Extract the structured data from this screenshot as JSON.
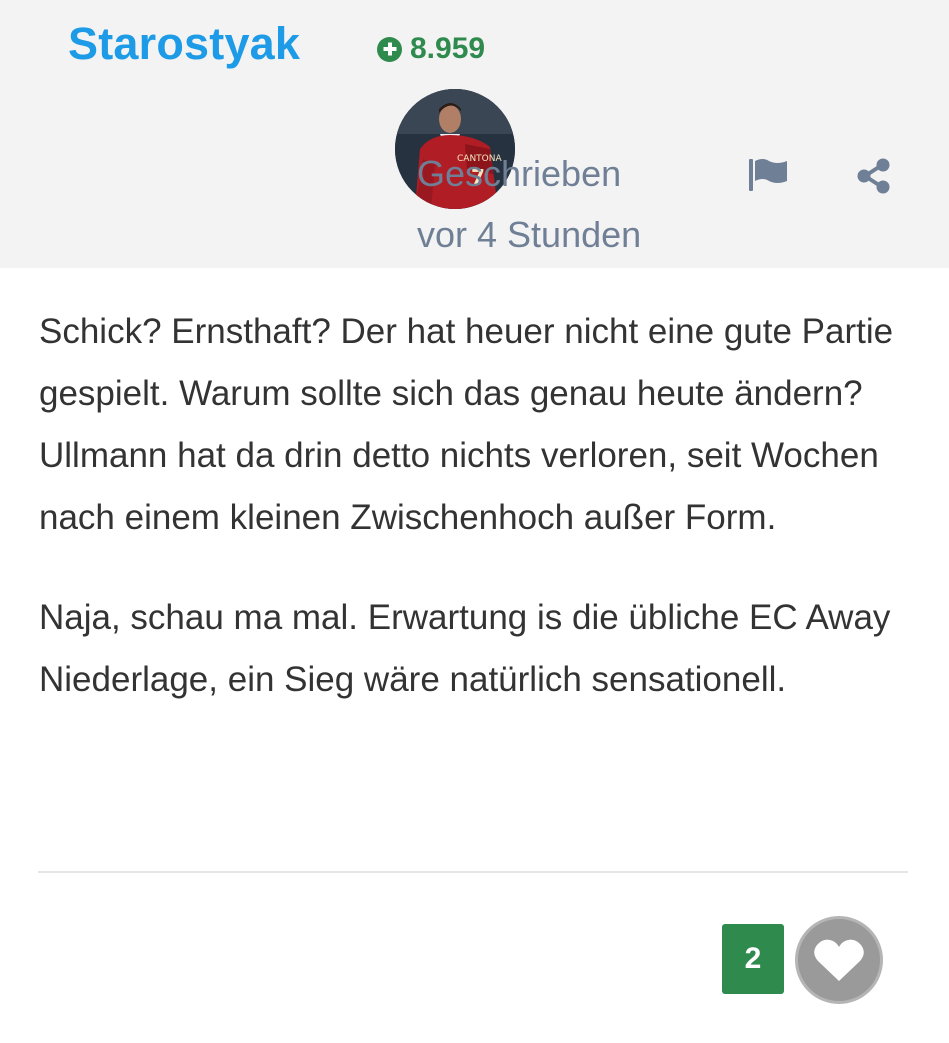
{
  "author": {
    "username": "Starostyak",
    "reputation": "8.959",
    "reputation_icon": "plus-circle-icon",
    "avatar_icon": "user-avatar"
  },
  "meta": {
    "posted_label": "Geschrieben",
    "posted_time": "vor 4 Stunden"
  },
  "actions": {
    "report_icon": "flag-icon",
    "share_icon": "share-icon"
  },
  "content": {
    "paragraphs": [
      "Schick? Ernsthaft? Der hat heuer nicht eine gute Partie gespielt. Warum sollte sich das genau heute ändern? Ullmann hat da drin detto nichts verloren, seit Wochen nach einem kleinen Zwischenhoch außer Form.",
      "Naja, schau ma mal. Erwartung is die übliche EC Away Niederlage, ein Sieg wäre natürlich sensationell."
    ]
  },
  "reactions": {
    "count": "2",
    "icon": "heart-icon"
  },
  "colors": {
    "username": "#1e9be6",
    "reputation": "#2f8a4e",
    "meta_text": "#6f7f95",
    "header_bg": "#f3f3f3",
    "like_count_bg": "#2f8a4e",
    "like_button_bg": "#9a9a9a"
  }
}
